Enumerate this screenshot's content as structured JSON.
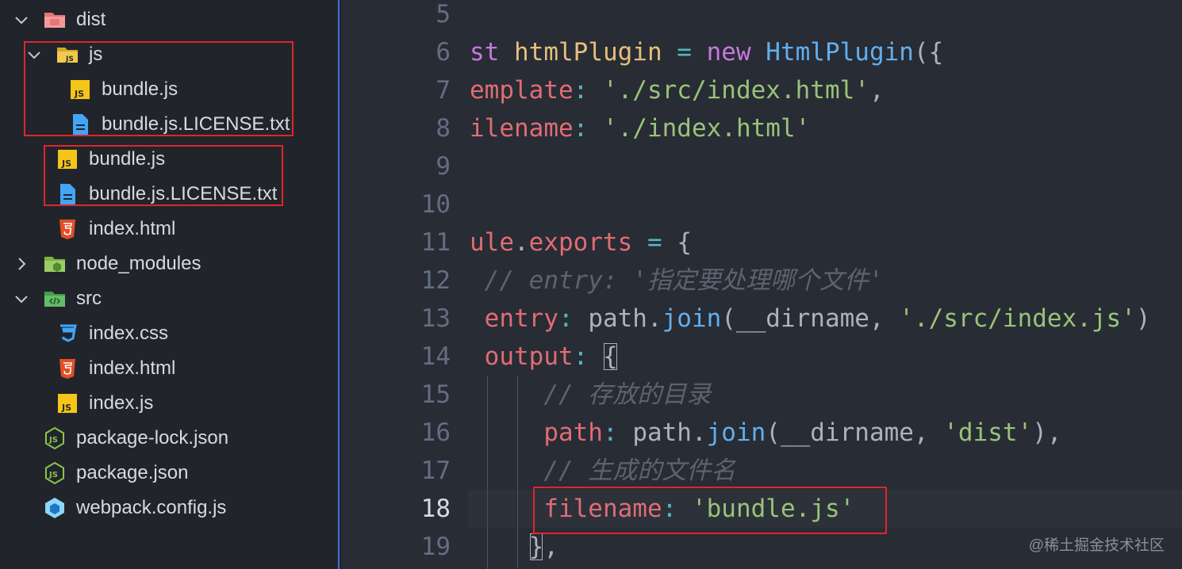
{
  "explorer": {
    "items": [
      {
        "label": "dist",
        "icon": "folder-dist-icon",
        "expanded": true
      },
      {
        "label": "js",
        "icon": "folder-js-icon",
        "expanded": true
      },
      {
        "label": "bundle.js",
        "icon": "js-file-icon"
      },
      {
        "label": "bundle.js.LICENSE.txt",
        "icon": "text-file-icon"
      },
      {
        "label": "bundle.js",
        "icon": "js-file-icon"
      },
      {
        "label": "bundle.js.LICENSE.txt",
        "icon": "text-file-icon"
      },
      {
        "label": "index.html",
        "icon": "html5-file-icon"
      },
      {
        "label": "node_modules",
        "icon": "folder-node-icon",
        "expanded": false
      },
      {
        "label": "src",
        "icon": "folder-src-icon",
        "expanded": true
      },
      {
        "label": "index.css",
        "icon": "css3-file-icon"
      },
      {
        "label": "index.html",
        "icon": "html5-file-icon"
      },
      {
        "label": "index.js",
        "icon": "js-file-icon"
      },
      {
        "label": "package-lock.json",
        "icon": "nodejs-file-icon"
      },
      {
        "label": "package.json",
        "icon": "nodejs-file-icon"
      },
      {
        "label": "webpack.config.js",
        "icon": "webpack-file-icon"
      }
    ]
  },
  "editor": {
    "active_line": "18",
    "lines": [
      {
        "n": "5",
        "tokens": []
      },
      {
        "n": "6",
        "tokens": [
          {
            "t": "st ",
            "c": "kw"
          },
          {
            "t": "htmlPlugin",
            "c": "var"
          },
          {
            "t": " = ",
            "c": "op"
          },
          {
            "t": "new ",
            "c": "kw"
          },
          {
            "t": "HtmlPlugin",
            "c": "fn"
          },
          {
            "t": "({",
            "c": "pl"
          }
        ]
      },
      {
        "n": "7",
        "tokens": [
          {
            "t": "emplate",
            "c": "prop"
          },
          {
            "t": ": ",
            "c": "op"
          },
          {
            "t": "'./src/index.html'",
            "c": "str"
          },
          {
            "t": ",",
            "c": "pl"
          }
        ]
      },
      {
        "n": "8",
        "tokens": [
          {
            "t": "ilename",
            "c": "prop"
          },
          {
            "t": ": ",
            "c": "op"
          },
          {
            "t": "'./index.html'",
            "c": "str"
          }
        ]
      },
      {
        "n": "9",
        "tokens": []
      },
      {
        "n": "10",
        "tokens": []
      },
      {
        "n": "11",
        "tokens": [
          {
            "t": "ule",
            "c": "prop"
          },
          {
            "t": ".",
            "c": "pl"
          },
          {
            "t": "exports",
            "c": "prop"
          },
          {
            "t": " = ",
            "c": "op"
          },
          {
            "t": "{",
            "c": "pl"
          }
        ]
      },
      {
        "n": "12",
        "tokens": [
          {
            "t": " // entry: '指定要处理哪个文件'",
            "c": "cm"
          }
        ]
      },
      {
        "n": "13",
        "tokens": [
          {
            "t": " entry",
            "c": "prop"
          },
          {
            "t": ": ",
            "c": "op"
          },
          {
            "t": "path",
            "c": "pl"
          },
          {
            "t": ".",
            "c": "pl"
          },
          {
            "t": "join",
            "c": "fn"
          },
          {
            "t": "(__dirname, ",
            "c": "pl"
          },
          {
            "t": "'./src/index.js'",
            "c": "str"
          },
          {
            "t": ")",
            "c": "pl"
          }
        ]
      },
      {
        "n": "14",
        "tokens": [
          {
            "t": " output",
            "c": "prop"
          },
          {
            "t": ": ",
            "c": "op"
          },
          {
            "t": "{",
            "c": "pl",
            "hl": true
          }
        ]
      },
      {
        "n": "15",
        "tokens": [
          {
            "t": "     // 存放的目录",
            "c": "cm"
          }
        ]
      },
      {
        "n": "16",
        "tokens": [
          {
            "t": "     path",
            "c": "prop"
          },
          {
            "t": ": ",
            "c": "op"
          },
          {
            "t": "path",
            "c": "pl"
          },
          {
            "t": ".",
            "c": "pl"
          },
          {
            "t": "join",
            "c": "fn"
          },
          {
            "t": "(__dirname, ",
            "c": "pl"
          },
          {
            "t": "'dist'",
            "c": "str"
          },
          {
            "t": "),",
            "c": "pl"
          }
        ]
      },
      {
        "n": "17",
        "tokens": [
          {
            "t": "     // 生成的文件名",
            "c": "cm"
          }
        ]
      },
      {
        "n": "18",
        "tokens": [
          {
            "t": "     filename",
            "c": "prop"
          },
          {
            "t": ": ",
            "c": "op"
          },
          {
            "t": "'bundle.js'",
            "c": "str"
          }
        ]
      },
      {
        "n": "19",
        "tokens": [
          {
            "t": "    ",
            "c": "pl"
          },
          {
            "t": "}",
            "c": "pl",
            "hl": true
          },
          {
            "t": ",",
            "c": "pl"
          }
        ]
      }
    ]
  },
  "watermark": "@稀土掘金技术社区",
  "colors": {
    "highlight_box": "#e0252b",
    "explorer_border": "#3e6fd8"
  }
}
